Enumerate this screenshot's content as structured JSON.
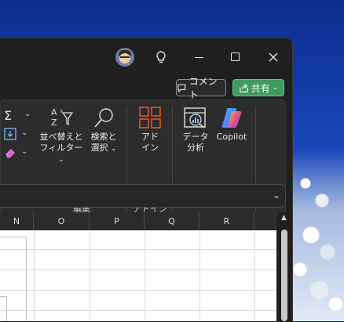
{
  "comment_button": {
    "label": "コメント"
  },
  "share_button": {
    "label": "共有"
  },
  "ribbon": {
    "sort_filter": {
      "line1": "並べ替えと",
      "line2": "フィルター"
    },
    "find_select": {
      "line1": "検索と",
      "line2": "選択"
    },
    "addins": {
      "line1": "アド",
      "line2": "イン"
    },
    "data_analysis": {
      "line1": "データ",
      "line2": "分析"
    },
    "copilot": {
      "label": "Copilot"
    },
    "groups": {
      "edit": "編集",
      "addins": "アドイン"
    }
  },
  "columns": [
    "N",
    "O",
    "P",
    "Q",
    "R"
  ]
}
